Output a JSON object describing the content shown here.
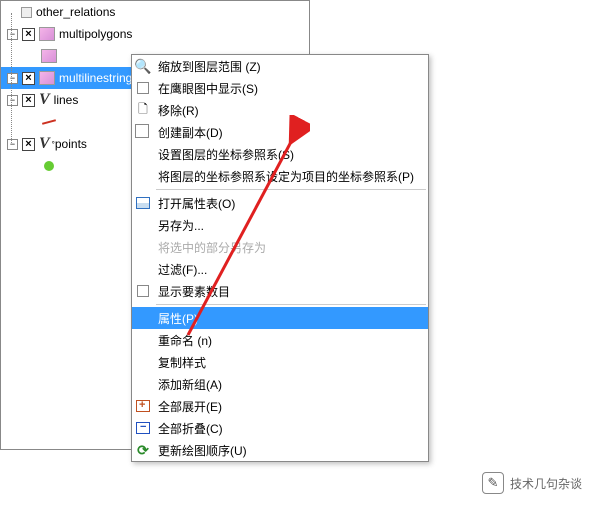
{
  "tree": {
    "items": [
      {
        "label": "other_relations",
        "expanded": false,
        "checked": false
      },
      {
        "label": "multipolygons",
        "expanded": true,
        "checked": true
      },
      {
        "label": "multilinestrings",
        "expanded": true,
        "checked": true,
        "selected": true
      },
      {
        "label": "lines",
        "expanded": true,
        "checked": true
      },
      {
        "label": "points",
        "expanded": true,
        "checked": true
      }
    ]
  },
  "menu": {
    "items": [
      {
        "label": "缩放到图层范围 (Z)",
        "icon": "zoom"
      },
      {
        "label": "在鹰眼图中显示(S)",
        "icon": "check"
      },
      {
        "label": "移除(R)",
        "icon": "remove"
      },
      {
        "label": "创建副本(D)",
        "icon": "copy"
      },
      {
        "label": "设置图层的坐标参照系(S)"
      },
      {
        "label": "将图层的坐标参照系设定为项目的坐标参照系(P)"
      },
      {
        "sep": true
      },
      {
        "label": "打开属性表(O)",
        "icon": "table"
      },
      {
        "label": "另存为..."
      },
      {
        "label": "将选中的部分另存为",
        "disabled": true
      },
      {
        "label": "过滤(F)..."
      },
      {
        "label": "显示要素数目",
        "icon": "check"
      },
      {
        "sep": true
      },
      {
        "label": "属性(P)",
        "highlighted": true
      },
      {
        "label": "重命名 (n)"
      },
      {
        "label": "复制样式"
      },
      {
        "label": "添加新组(A)"
      },
      {
        "label": "全部展开(E)",
        "icon": "expand"
      },
      {
        "label": "全部折叠(C)",
        "icon": "collapse"
      },
      {
        "label": "更新绘图顺序(U)",
        "icon": "refresh"
      }
    ]
  },
  "watermark": {
    "text": "技术几句杂谈"
  }
}
